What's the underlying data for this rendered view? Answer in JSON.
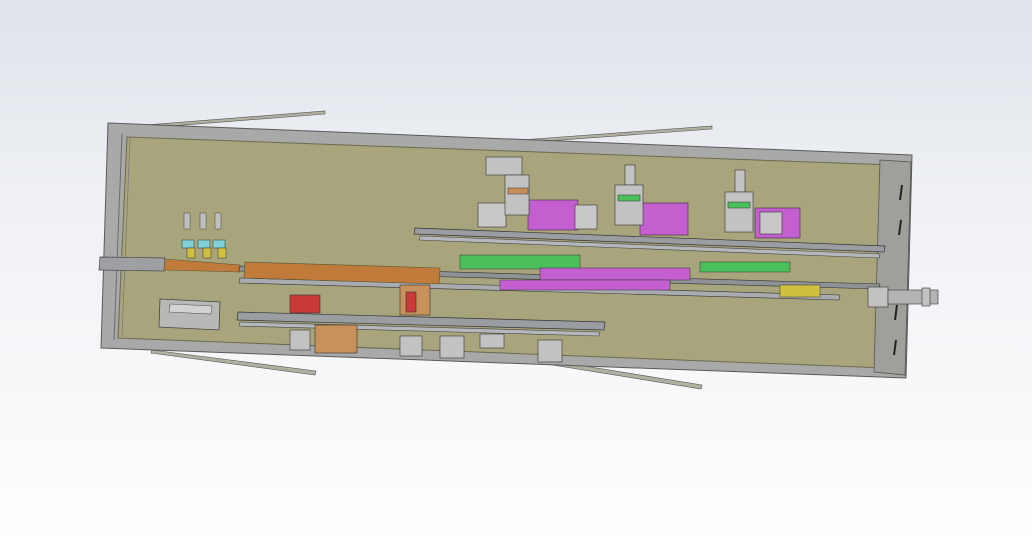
{
  "viewport": {
    "background_top": "#dfe3ea",
    "background_bottom": "#ffffff"
  },
  "model": {
    "frame_color": "#a9a9a9",
    "frame_edge": "#5a5a5a",
    "panel_color": "#a8a57c",
    "rail_color": "#9a9da2",
    "accent_colors": [
      "#c45fd0",
      "#4bbf5a",
      "#d08a3a",
      "#c93a3a",
      "#c8905a",
      "#7fd0d8"
    ]
  }
}
